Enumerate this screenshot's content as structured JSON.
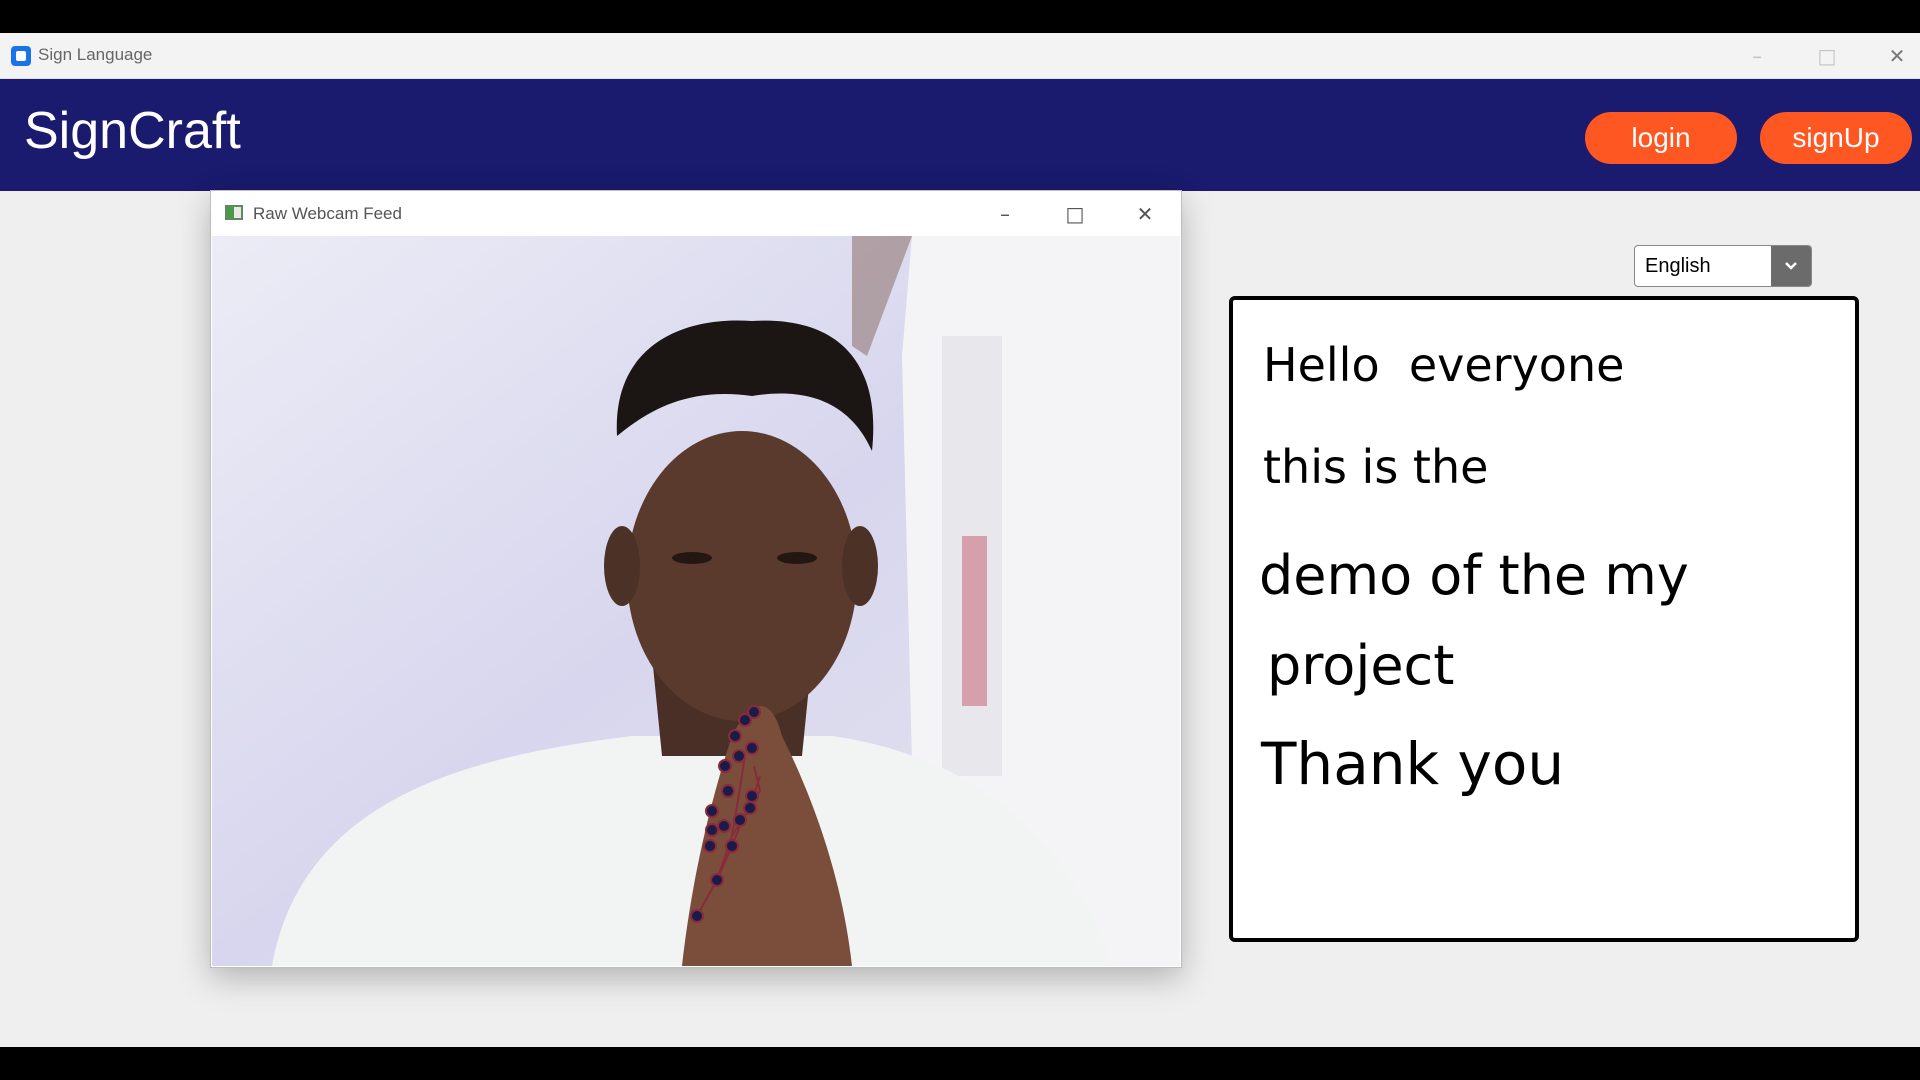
{
  "window": {
    "title": "Sign Language",
    "minimize_icon": "minimize-icon",
    "maximize_icon": "maximize-icon",
    "close_icon": "close-icon"
  },
  "header": {
    "brand": "SignCraft",
    "login_label": "login",
    "signup_label": "signUp",
    "background_color": "#1a1a6e",
    "button_color": "#ff5722"
  },
  "webcam_window": {
    "title": "Raw Webcam Feed"
  },
  "language_select": {
    "selected": "English"
  },
  "output_panel": {
    "lines": [
      "Hello  everyone",
      "this is the",
      "demo of the my",
      "project",
      "Thank you"
    ]
  }
}
